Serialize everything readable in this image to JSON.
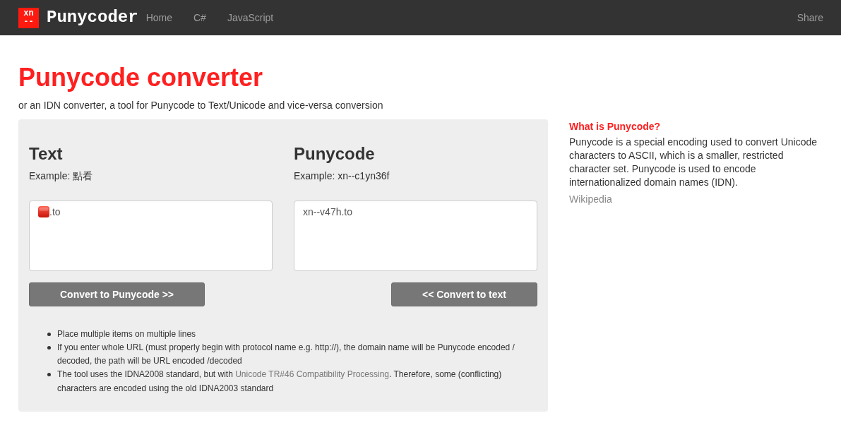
{
  "navbar": {
    "logo": [
      "xn",
      "--"
    ],
    "brand": "Punycoder",
    "links": [
      {
        "label": "Home"
      },
      {
        "label": "C#"
      },
      {
        "label": "JavaScript"
      }
    ],
    "share": "Share"
  },
  "page": {
    "title": "Punycode converter",
    "subtitle": "or an IDN converter, a tool for Punycode to Text/Unicode and vice-versa conversion"
  },
  "converter": {
    "columns": [
      {
        "heading": "Text",
        "example": "Example: 點看",
        "field": {
          "kind": "emoji_prefixed",
          "value": ".to"
        },
        "button": "Convert to Punycode >>"
      },
      {
        "heading": "Punycode",
        "example": "Example: xn--c1yn36f",
        "field": {
          "kind": "plain",
          "value": "xn--v47h.to"
        },
        "button": "<< Convert to text"
      }
    ],
    "notes": [
      {
        "text": "Place multiple items on multiple lines"
      },
      {
        "text": "If you enter whole URL (must properly begin with protocol name e.g. http://), the domain name will be Punycode encoded / decoded, the path will be URL encoded /decoded"
      },
      {
        "text": "The tool uses the IDNA2008 standard, but with ",
        "link": "Unicode TR#46 Compatibility Processing",
        "after": ". Therefore, some (conflicting) characters are encoded using the old IDNA2003 standard"
      }
    ]
  },
  "sidebar": {
    "heading": "What is Punycode?",
    "text": "Punycode is a special encoding used to convert Unicode characters to ASCII, which is a smaller, restricted character set. Punycode is used to encode internationalized domain names (IDN).",
    "link": "Wikipedia"
  }
}
